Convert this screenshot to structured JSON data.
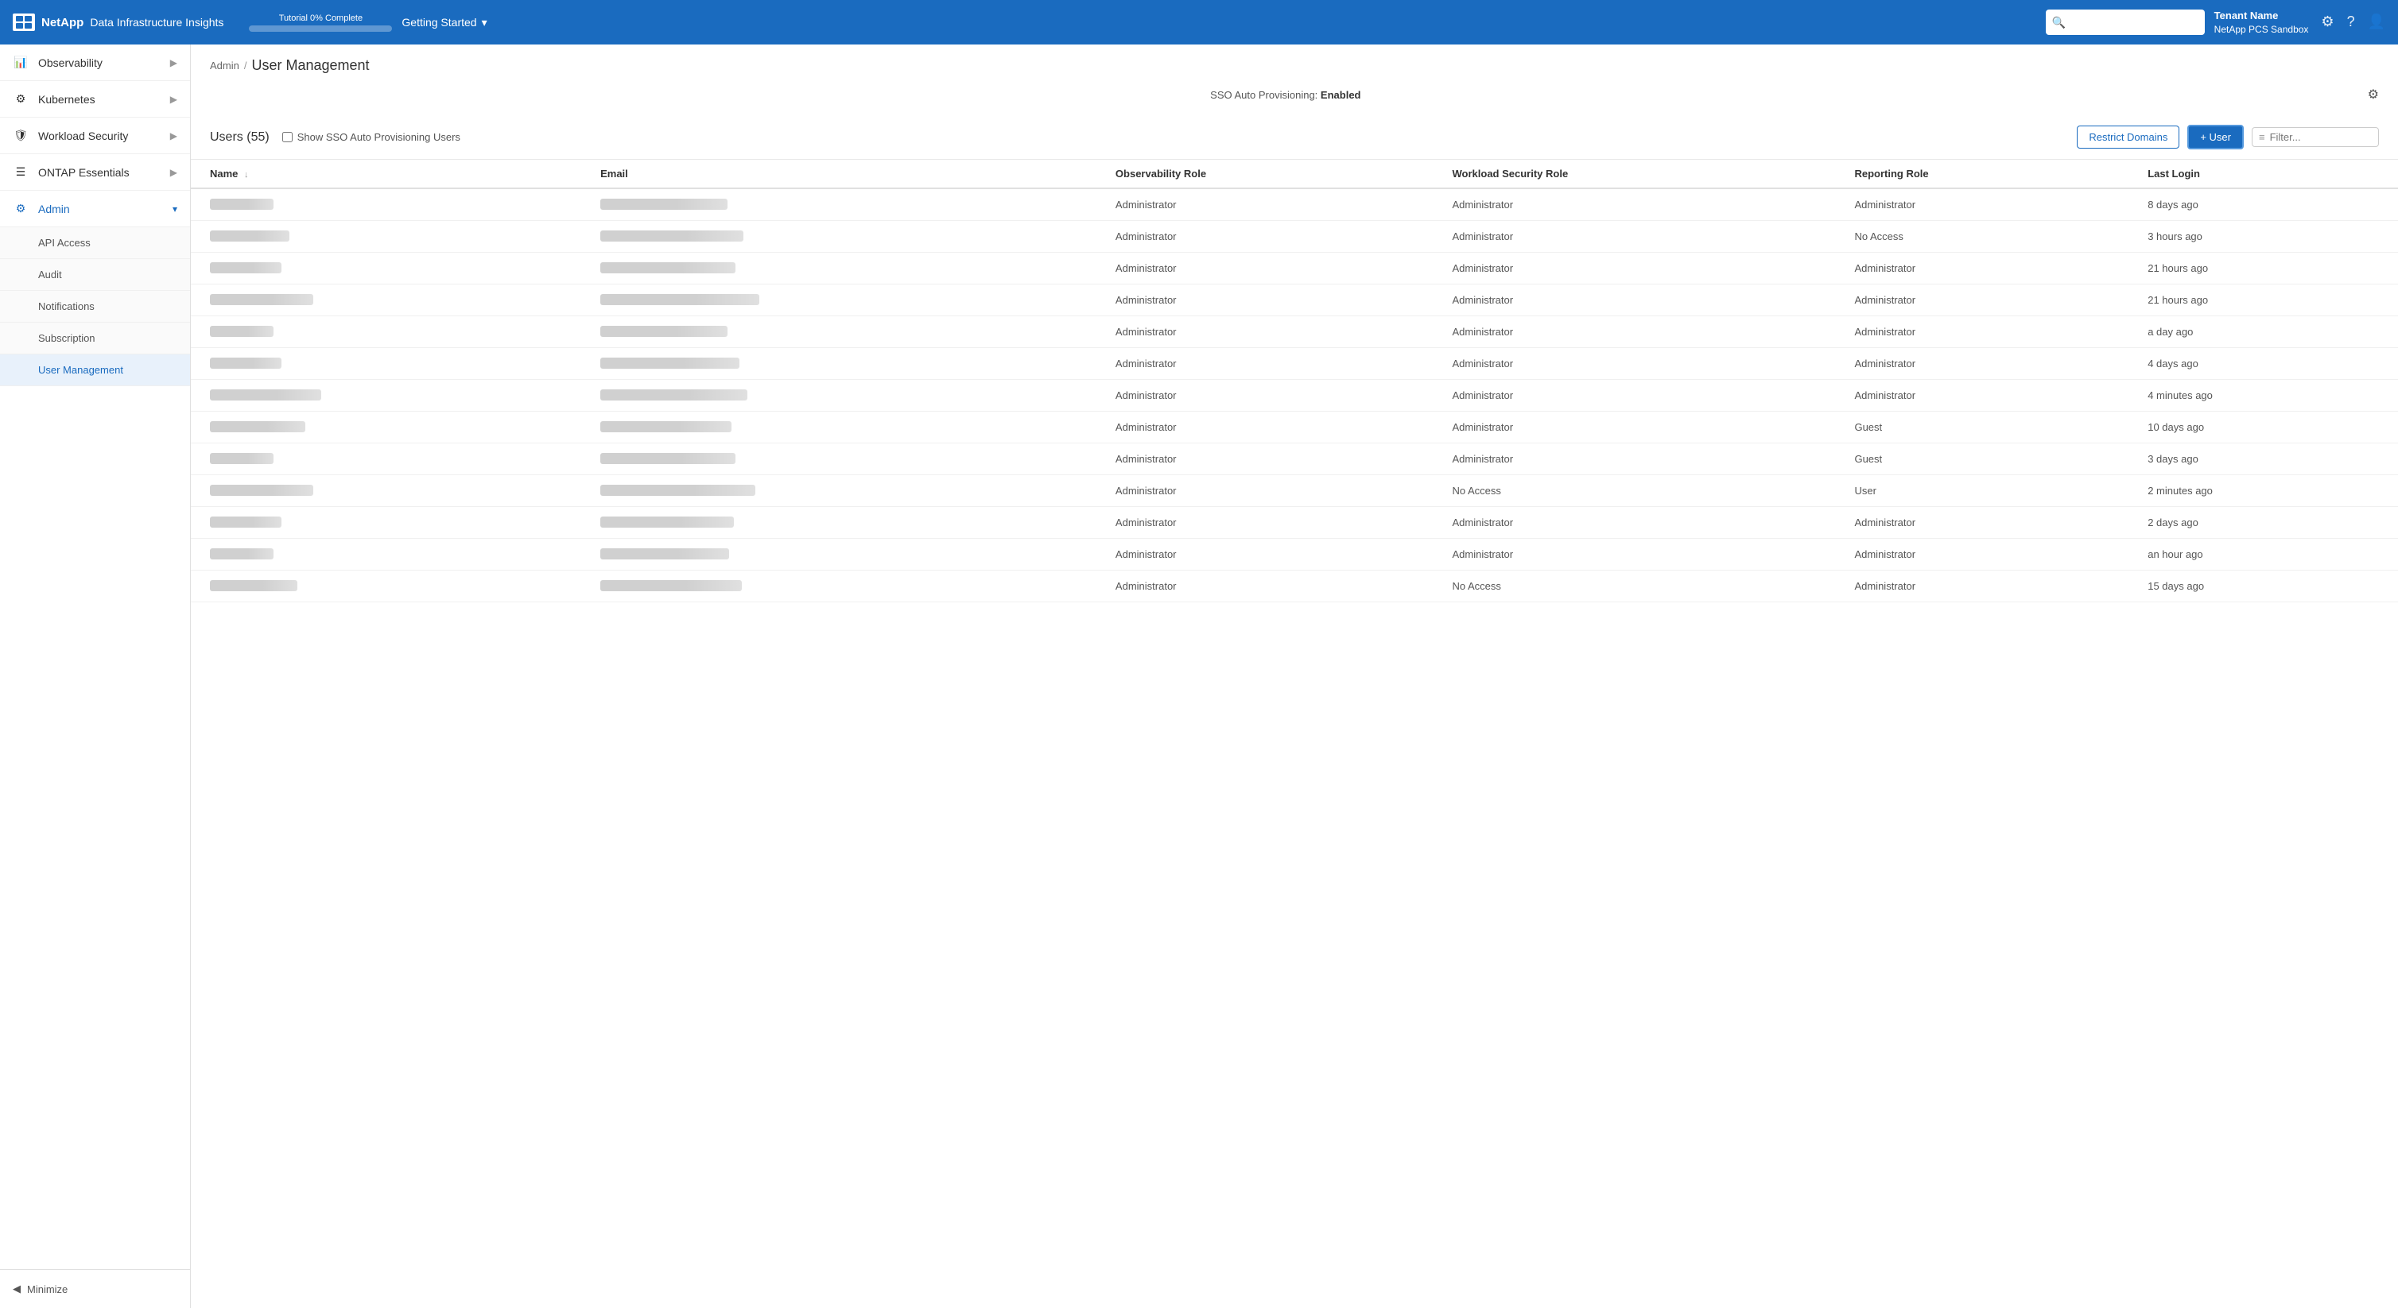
{
  "header": {
    "logo_text": "NetApp",
    "app_name": "Data Infrastructure Insights",
    "tutorial_label": "Tutorial 0% Complete",
    "tutorial_pct": 0,
    "getting_started": "Getting Started",
    "search_placeholder": "",
    "tenant_name": "Tenant Name",
    "tenant_sub": "NetApp PCS Sandbox"
  },
  "sidebar": {
    "items": [
      {
        "id": "observability",
        "label": "Observability",
        "icon": "bar-chart",
        "has_children": true,
        "active": false
      },
      {
        "id": "kubernetes",
        "label": "Kubernetes",
        "icon": "gear",
        "has_children": true,
        "active": false
      },
      {
        "id": "workload-security",
        "label": "Workload Security",
        "icon": "shield",
        "has_children": true,
        "active": false
      },
      {
        "id": "ontap-essentials",
        "label": "ONTAP Essentials",
        "icon": "list",
        "has_children": true,
        "active": false
      },
      {
        "id": "admin",
        "label": "Admin",
        "icon": "settings-gear",
        "has_children": true,
        "active": true,
        "expanded": true
      }
    ],
    "sub_items": [
      {
        "id": "api-access",
        "label": "API Access",
        "active": false
      },
      {
        "id": "audit",
        "label": "Audit",
        "active": false
      },
      {
        "id": "notifications",
        "label": "Notifications",
        "active": false
      },
      {
        "id": "subscription",
        "label": "Subscription",
        "active": false
      },
      {
        "id": "user-management",
        "label": "User Management",
        "active": true
      }
    ],
    "minimize": "Minimize"
  },
  "breadcrumb": {
    "parent": "Admin",
    "current": "User Management"
  },
  "sso": {
    "label": "SSO Auto Provisioning:",
    "status": "Enabled"
  },
  "users_section": {
    "title": "Users",
    "count": 55,
    "show_sso_label": "Show SSO Auto Provisioning Users",
    "restrict_domains": "Restrict Domains",
    "add_user": "+ User",
    "filter_placeholder": "Filter..."
  },
  "table": {
    "columns": [
      {
        "id": "name",
        "label": "Name",
        "sortable": true
      },
      {
        "id": "email",
        "label": "Email",
        "sortable": false
      },
      {
        "id": "observability_role",
        "label": "Observability Role",
        "sortable": false
      },
      {
        "id": "workload_security_role",
        "label": "Workload Security Role",
        "sortable": false
      },
      {
        "id": "reporting_role",
        "label": "Reporting Role",
        "sortable": false
      },
      {
        "id": "last_login",
        "label": "Last Login",
        "sortable": false
      }
    ],
    "rows": [
      {
        "obs_role": "Administrator",
        "ws_role": "Administrator",
        "rep_role": "Administrator",
        "last_login": "8 days ago"
      },
      {
        "obs_role": "Administrator",
        "ws_role": "Administrator",
        "rep_role": "No Access",
        "last_login": "3 hours ago"
      },
      {
        "obs_role": "Administrator",
        "ws_role": "Administrator",
        "rep_role": "Administrator",
        "last_login": "21 hours ago"
      },
      {
        "obs_role": "Administrator",
        "ws_role": "Administrator",
        "rep_role": "Administrator",
        "last_login": "21 hours ago"
      },
      {
        "obs_role": "Administrator",
        "ws_role": "Administrator",
        "rep_role": "Administrator",
        "last_login": "a day ago"
      },
      {
        "obs_role": "Administrator",
        "ws_role": "Administrator",
        "rep_role": "Administrator",
        "last_login": "4 days ago"
      },
      {
        "obs_role": "Administrator",
        "ws_role": "Administrator",
        "rep_role": "Administrator",
        "last_login": "4 minutes ago"
      },
      {
        "obs_role": "Administrator",
        "ws_role": "Administrator",
        "rep_role": "Guest",
        "last_login": "10 days ago"
      },
      {
        "obs_role": "Administrator",
        "ws_role": "Administrator",
        "rep_role": "Guest",
        "last_login": "3 days ago"
      },
      {
        "obs_role": "Administrator",
        "ws_role": "No Access",
        "rep_role": "User",
        "last_login": "2 minutes ago"
      },
      {
        "obs_role": "Administrator",
        "ws_role": "Administrator",
        "rep_role": "Administrator",
        "last_login": "2 days ago"
      },
      {
        "obs_role": "Administrator",
        "ws_role": "Administrator",
        "rep_role": "Administrator",
        "last_login": "an hour ago"
      },
      {
        "obs_role": "Administrator",
        "ws_role": "No Access",
        "rep_role": "Administrator",
        "last_login": "15 days ago"
      }
    ]
  }
}
